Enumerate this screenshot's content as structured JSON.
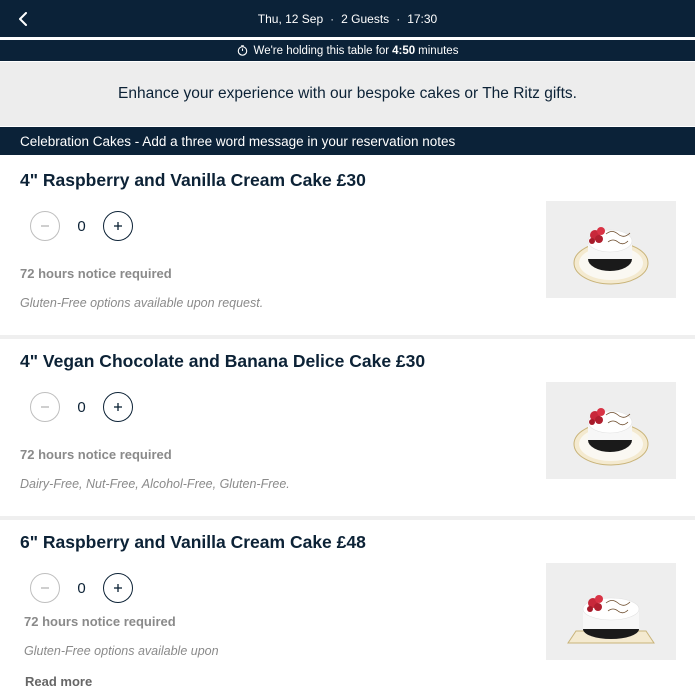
{
  "header": {
    "date": "Thu, 12 Sep",
    "guests": "2 Guests",
    "time": "17:30",
    "separator": "·"
  },
  "hold_banner": {
    "prefix": "We're holding this table for",
    "countdown": "4:50",
    "suffix": "minutes"
  },
  "enhance_text": "Enhance your experience with our bespoke cakes or The Ritz gifts.",
  "section": {
    "title": "Celebration Cakes - Add a three word message in your reservation notes"
  },
  "cakes": [
    {
      "title": "4\" Raspberry and Vanilla Cream Cake £30",
      "quantity": "0",
      "notice": "72 hours notice required",
      "description": "Gluten-Free options available upon request."
    },
    {
      "title": "4\" Vegan Chocolate and Banana Delice Cake £30",
      "quantity": "0",
      "notice": "72 hours notice required",
      "description": "Dairy-Free, Nut-Free, Alcohol-Free, Gluten-Free."
    },
    {
      "title": "6\" Raspberry and Vanilla Cream Cake £48",
      "quantity": "0",
      "notice": "72 hours notice required",
      "description": "Gluten-Free options available upon",
      "read_more": "Read more"
    }
  ],
  "colors": {
    "navy": "#0b2238",
    "grey_band": "#ededed",
    "muted_text": "#8a8a8a"
  },
  "icons": {
    "back": "chevron-left-icon",
    "clock": "clock-icon",
    "minus": "minus-icon",
    "plus": "plus-icon"
  }
}
